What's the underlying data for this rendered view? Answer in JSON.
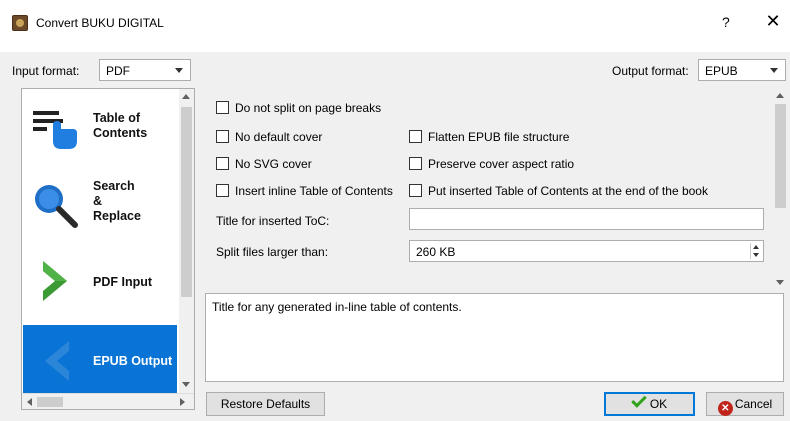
{
  "window": {
    "title": "Convert BUKU DIGITAL",
    "help_glyph": "?",
    "close_glyph": "✕"
  },
  "input_format": {
    "label": "Input format:",
    "value": "PDF"
  },
  "output_format": {
    "label": "Output format:",
    "value": "EPUB"
  },
  "sidebar": {
    "items": [
      {
        "label": "Table of\nContents",
        "icon": "toc-icon",
        "active": false
      },
      {
        "label": "Search\n&\nReplace",
        "icon": "search-icon",
        "active": false
      },
      {
        "label": "PDF Input",
        "icon": "chevron-right-icon",
        "active": false
      },
      {
        "label": "EPUB Output",
        "icon": "chevron-left-icon",
        "active": true
      }
    ]
  },
  "options": {
    "no_split_page_breaks": {
      "label": "Do not split on page breaks",
      "checked": false
    },
    "no_default_cover": {
      "label": "No default cover",
      "checked": false
    },
    "flatten_epub": {
      "label": "Flatten EPUB file structure",
      "checked": false
    },
    "no_svg_cover": {
      "label": "No SVG cover",
      "checked": false
    },
    "preserve_aspect": {
      "label": "Preserve cover aspect ratio",
      "checked": false
    },
    "insert_inline_toc": {
      "label": "Insert inline Table of Contents",
      "checked": false
    },
    "toc_at_end": {
      "label": "Put inserted Table of Contents at the end of the book",
      "checked": false
    },
    "toc_title": {
      "label": "Title for inserted ToC:",
      "value": ""
    },
    "split_files": {
      "label": "Split files larger than:",
      "value": "260 KB"
    }
  },
  "help_text": "Title for any generated in-line table of contents.",
  "buttons": {
    "restore": "Restore Defaults",
    "ok": "OK",
    "cancel": "Cancel"
  },
  "colors": {
    "accent": "#0a74d6",
    "ok_check": "#2fa31a",
    "cancel_icon": "#c0241b"
  }
}
